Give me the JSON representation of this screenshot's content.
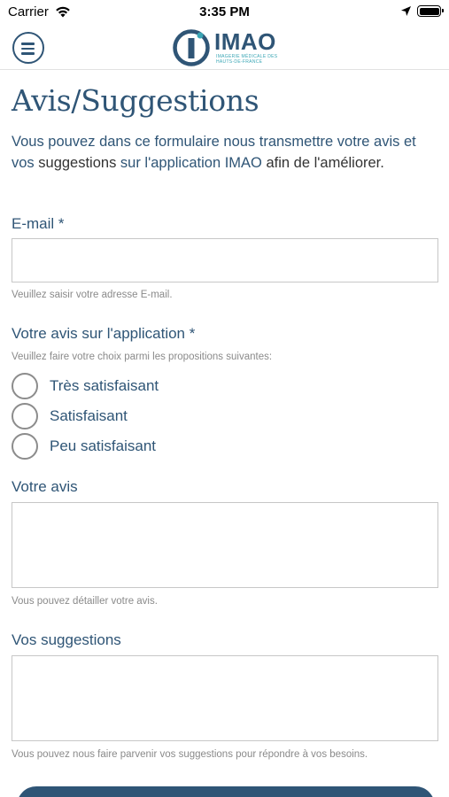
{
  "status_bar": {
    "carrier": "Carrier",
    "time": "3:35 PM"
  },
  "header": {
    "logo_text": "IMAO",
    "logo_subtitle": "IMAGERIE MÉDICALE DES HAUTS-DE-FRANCE",
    "brand_color": "#2f5576",
    "accent_color": "#3aa6b5"
  },
  "page": {
    "title": "Avis/Suggestions",
    "intro_part1": "Vous pouvez dans ce formulaire nous transmettre votre avis et vos ",
    "intro_part2": "suggestions",
    "intro_part3": " sur l'application IMAO ",
    "intro_part4": "afin de l'améliorer."
  },
  "form": {
    "email": {
      "label": "E-mail *",
      "value": "",
      "hint": "Veuillez saisir votre adresse E-mail."
    },
    "rating": {
      "label": "Votre avis sur l'application *",
      "hint": "Veuillez faire votre choix parmi les propositions suivantes:",
      "options": [
        "Très satisfaisant",
        "Satisfaisant",
        "Peu satisfaisant"
      ],
      "selected": null
    },
    "opinion": {
      "label": "Votre avis",
      "value": "",
      "hint": "Vous pouvez détailler votre avis."
    },
    "suggestions": {
      "label": "Vos suggestions",
      "value": "",
      "hint": "Vous pouvez nous faire parvenir vos suggestions pour répondre à vos  besoins."
    }
  }
}
